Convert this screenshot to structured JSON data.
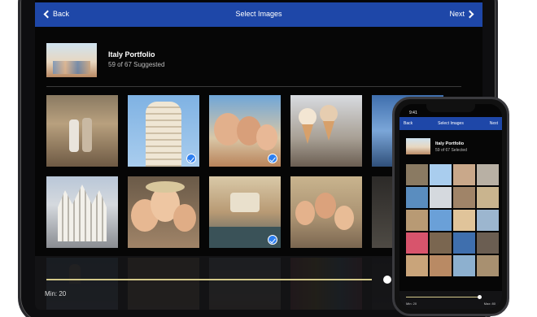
{
  "tablet": {
    "nav": {
      "back_label": "Back",
      "title": "Select Images",
      "next_label": "Next"
    },
    "portfolio": {
      "name": "Italy Portfolio",
      "subtitle": "59 of 67 Suggested"
    },
    "slider": {
      "min_label": "Min: 20"
    }
  },
  "phone": {
    "status_time": "9:41",
    "nav": {
      "back_label": "Back",
      "title": "Select Images",
      "next_label": "Next"
    },
    "portfolio": {
      "name": "Italy Portfolio",
      "subtitle": "59 of 67 Selected"
    },
    "slider": {
      "min_label": "Min: 20",
      "max_label": "Max: 80"
    }
  },
  "colors": {
    "nav_blue": "#1e47a8",
    "check_blue": "#2d7ff0",
    "slider_track": "#d4c98a"
  },
  "icons": [
    "chevron-left-icon",
    "chevron-right-icon",
    "selected-check-icon"
  ]
}
